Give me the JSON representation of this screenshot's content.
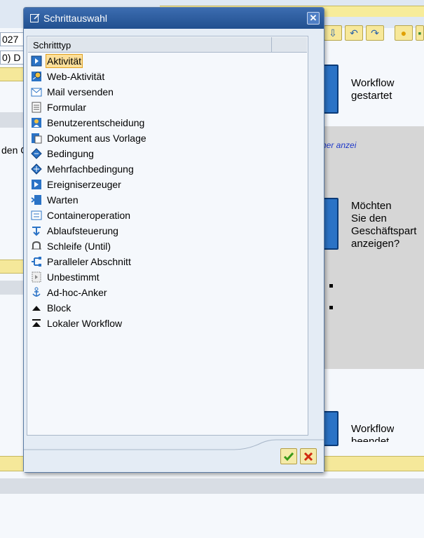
{
  "background": {
    "field_1_value": "027",
    "field_2_value": "0) D",
    "field_3_value": "den C",
    "node_1_text": "Workflow\ngestartet",
    "node_2_text": "Möchten\nSie den\nGeschäftspart\nanzeigen?",
    "node_3_text": "Workflow\nbeendet",
    "link_text": "rner anzei"
  },
  "dialog": {
    "title": "Schrittauswahl",
    "column_header": "Schritttyp",
    "items": [
      {
        "label": "Aktivität",
        "icon": "activity-icon",
        "selected": true
      },
      {
        "label": "Web-Aktivität",
        "icon": "web-activity-icon",
        "selected": false
      },
      {
        "label": "Mail versenden",
        "icon": "mail-icon",
        "selected": false
      },
      {
        "label": "Formular",
        "icon": "form-icon",
        "selected": false
      },
      {
        "label": "Benutzerentscheidung",
        "icon": "user-decision-icon",
        "selected": false
      },
      {
        "label": "Dokument aus Vorlage",
        "icon": "document-template-icon",
        "selected": false
      },
      {
        "label": "Bedingung",
        "icon": "condition-icon",
        "selected": false
      },
      {
        "label": "Mehrfachbedingung",
        "icon": "multiple-condition-icon",
        "selected": false
      },
      {
        "label": "Ereigniserzeuger",
        "icon": "event-creator-icon",
        "selected": false
      },
      {
        "label": "Warten",
        "icon": "wait-icon",
        "selected": false
      },
      {
        "label": "Containeroperation",
        "icon": "container-operation-icon",
        "selected": false
      },
      {
        "label": "Ablaufsteuerung",
        "icon": "process-control-icon",
        "selected": false
      },
      {
        "label": "Schleife (Until)",
        "icon": "loop-icon",
        "selected": false
      },
      {
        "label": "Paralleler Abschnitt",
        "icon": "parallel-section-icon",
        "selected": false
      },
      {
        "label": "Unbestimmt",
        "icon": "undefined-icon",
        "selected": false
      },
      {
        "label": "Ad-hoc-Anker",
        "icon": "anchor-icon",
        "selected": false
      },
      {
        "label": "Block",
        "icon": "block-icon",
        "selected": false
      },
      {
        "label": "Lokaler Workflow",
        "icon": "local-workflow-icon",
        "selected": false
      }
    ]
  },
  "colors": {
    "titlebar": "#2b5a9c",
    "selection": "#fcdf9a",
    "toolbar_yellow": "#f5e89a",
    "node_blue": "#2b73c6"
  }
}
